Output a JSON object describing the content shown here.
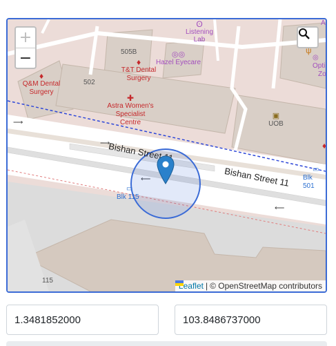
{
  "map": {
    "road_name_upper": "Bishan Street 11",
    "road_name_lower": "Bishan Street 11",
    "pois": {
      "listening_lab": [
        "Listening",
        "Lab"
      ],
      "hazel_eyecare": "Hazel Eyecare",
      "tt_dental": [
        "T&T Dental",
        "Surgery"
      ],
      "qm_dental": [
        "Q&M Dental",
        "Surgery"
      ],
      "astra_womens": [
        "Astra Women's",
        "Specialist",
        "Centre"
      ],
      "uob": "UOB",
      "optical_partial": [
        "Opti",
        "Zo"
      ],
      "top_right_partial": "Ab"
    },
    "buildings": {
      "b505b": "505B",
      "b502": "502",
      "b115": "115"
    },
    "bus_stops": {
      "left": "Blk 115",
      "right": "Blk 501"
    },
    "zoom_in": "+",
    "zoom_out": "−",
    "attribution": {
      "leaflet": "Leaflet",
      "separator": "|",
      "osm": "© OpenStreetMap contributors"
    }
  },
  "coordinates": {
    "latitude": "1.3481852000",
    "longitude": "103.8486737000"
  },
  "colors": {
    "accent": "#3b6bd6",
    "marker": "#2a81cb",
    "poi_red": "#c5282b",
    "poi_purple": "#a24ebd",
    "poi_blue": "#2a6fd1"
  }
}
